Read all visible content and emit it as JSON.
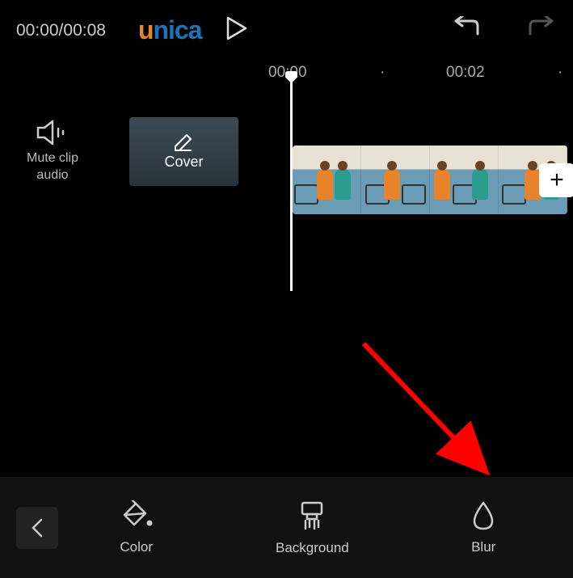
{
  "timecode": "00:00/00:08",
  "logo": {
    "u": "u",
    "n": "n",
    "i": "i",
    "c": "c",
    "a": "a"
  },
  "timeline": {
    "marks": [
      "00:00",
      "00:02"
    ]
  },
  "mute_clip_label": "Mute clip\naudio",
  "cover_label": "Cover",
  "toolbar": {
    "color": "Color",
    "background": "Background",
    "blur": "Blur"
  },
  "add_button": "+"
}
